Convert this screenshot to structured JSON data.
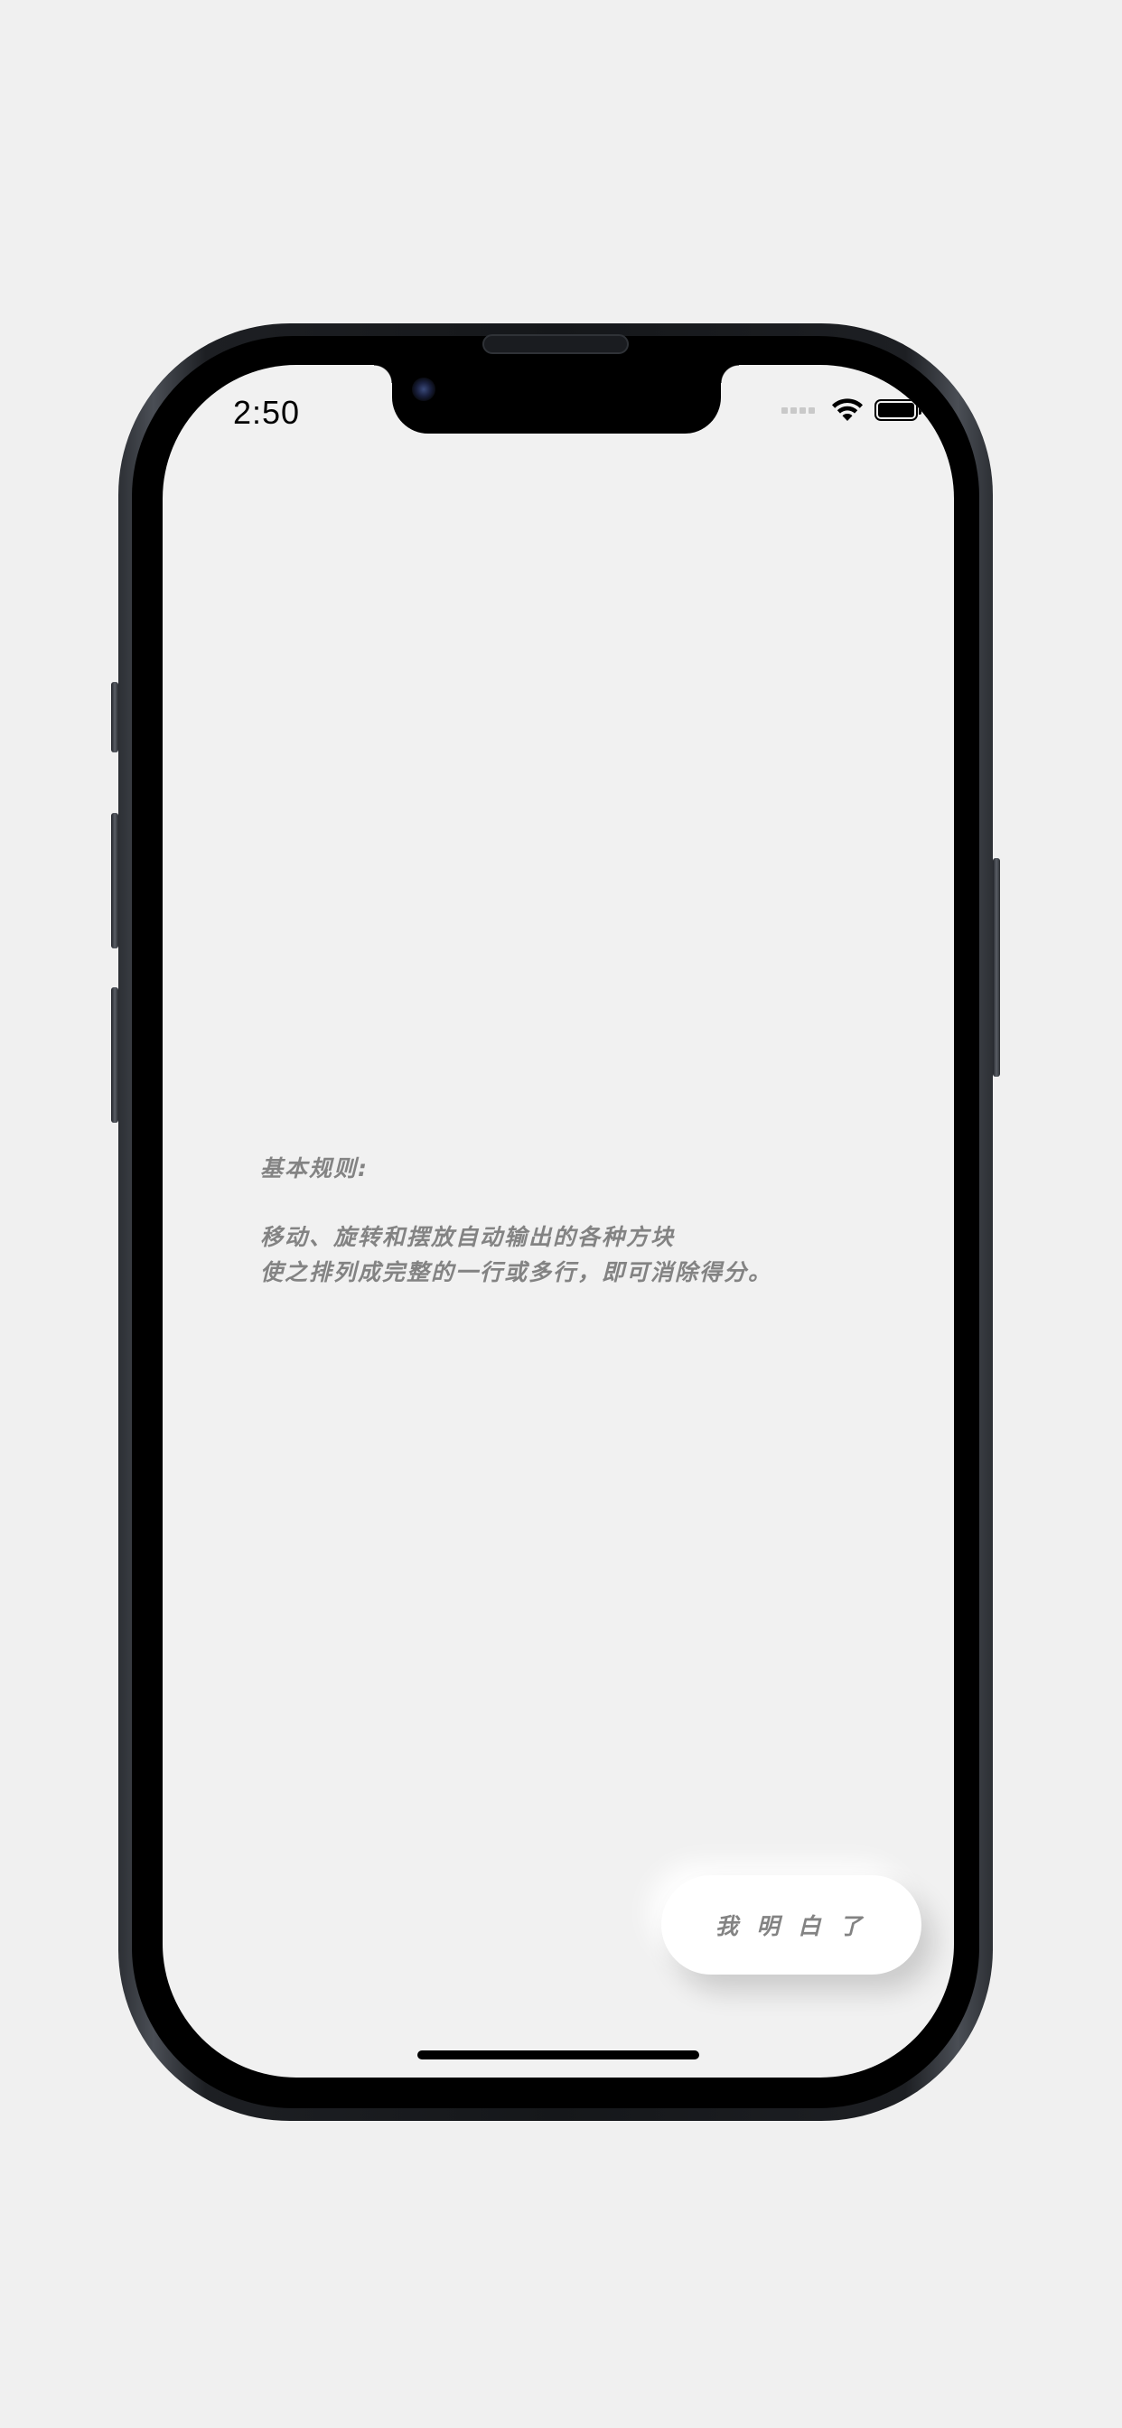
{
  "status_bar": {
    "time": "2:50",
    "wifi_icon": "wifi-icon",
    "battery_icon": "battery-icon",
    "signal_icon": "cellular-signal-icon"
  },
  "rules": {
    "heading": "基本规则:",
    "line1": "移动、旋转和摆放自动输出的各种方块",
    "line2": "使之排列成完整的一行或多行，即可消除得分。"
  },
  "actions": {
    "confirm_label": "我 明 白 了"
  },
  "colors": {
    "background": "#f1f1f1",
    "text": "#838383",
    "button": "#ffffff"
  }
}
